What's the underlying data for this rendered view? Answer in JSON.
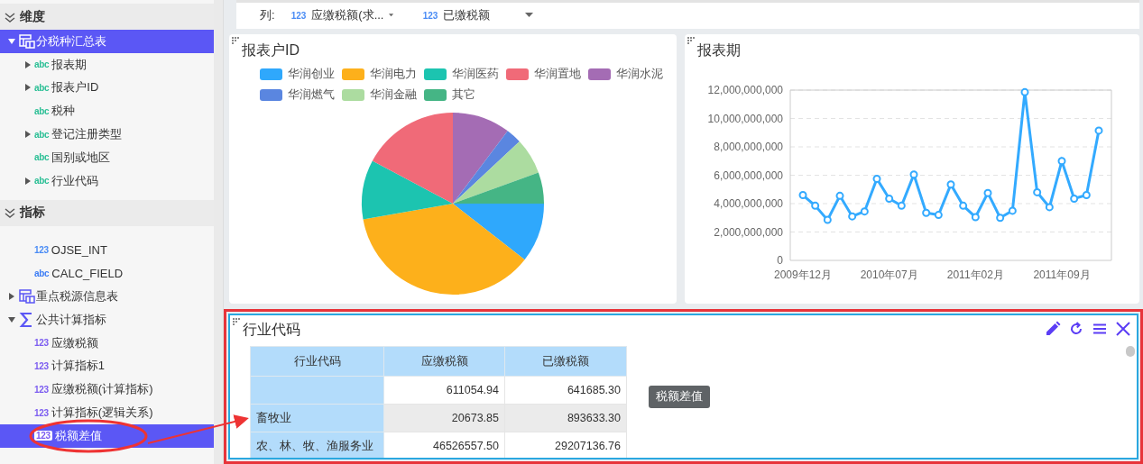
{
  "sidebar": {
    "sections": [
      {
        "title": "维度",
        "items": [
          {
            "label": "分税种汇总表",
            "kind": "table",
            "expanded": true,
            "selected": true,
            "children": [
              {
                "label": "报表期",
                "kind": "field",
                "type_label": "abc",
                "color": "#2bbf95",
                "expanded": false,
                "selected": false
              },
              {
                "label": "报表户ID",
                "kind": "field",
                "type_label": "abc",
                "color": "#2bbf95",
                "expanded": false,
                "selected": false
              },
              {
                "label": "税种",
                "kind": "field",
                "type_label": "abc",
                "color": "#2bbf95",
                "selected": false
              },
              {
                "label": "登记注册类型",
                "kind": "field",
                "type_label": "abc",
                "color": "#2bbf95",
                "expanded": false,
                "selected": false
              },
              {
                "label": "国别或地区",
                "kind": "field",
                "type_label": "abc",
                "color": "#2bbf95",
                "selected": false
              },
              {
                "label": "行业代码",
                "kind": "field",
                "type_label": "abc",
                "color": "#2bbf95",
                "expanded": false,
                "selected": false
              }
            ]
          }
        ]
      },
      {
        "title": "指标",
        "items": [
          {
            "label": "OJSE_INT",
            "kind": "field",
            "type_label": "123",
            "color": "#4a8cf5",
            "selected": false
          },
          {
            "label": "CALC_FIELD",
            "kind": "field",
            "type_label": "abc",
            "color": "#3d7df5",
            "selected": false
          },
          {
            "label": "重点税源信息表",
            "kind": "table",
            "expanded": false,
            "selected": false
          },
          {
            "label": "公共计算指标",
            "kind": "group",
            "expanded": true,
            "selected": false,
            "children": [
              {
                "label": "应缴税额",
                "kind": "field",
                "type_label": "123",
                "color": "#7b5cf0",
                "selected": false
              },
              {
                "label": "计算指标1",
                "kind": "field",
                "type_label": "123",
                "color": "#7b5cf0",
                "selected": false
              },
              {
                "label": "应缴税额(计算指标)",
                "kind": "field",
                "type_label": "123",
                "color": "#7b5cf0",
                "selected": false
              },
              {
                "label": "计算指标(逻辑关系)",
                "kind": "field",
                "type_label": "123",
                "color": "#7b5cf0",
                "selected": false
              },
              {
                "label": "税额差值",
                "kind": "field",
                "type_label": "123",
                "color": "#7b5cf0",
                "selected": true
              }
            ]
          }
        ]
      }
    ]
  },
  "toolbar": {
    "label": "列:",
    "fields": [
      {
        "type_label": "123",
        "text": "应缴税额(求..."
      },
      {
        "type_label": "123",
        "text": "已缴税额"
      }
    ]
  },
  "pie_panel": {
    "title": "报表户ID",
    "legend": [
      {
        "label": "华润创业",
        "color": "#2fa8fc"
      },
      {
        "label": "华润电力",
        "color": "#fdb01b"
      },
      {
        "label": "华润医药",
        "color": "#1cc4b0"
      },
      {
        "label": "华润置地",
        "color": "#f06a78"
      },
      {
        "label": "华润水泥",
        "color": "#a46cb4"
      },
      {
        "label": "华润燃气",
        "color": "#5a86e0"
      },
      {
        "label": "华润金融",
        "color": "#acdca0"
      },
      {
        "label": "其它",
        "color": "#45b585"
      }
    ]
  },
  "line_panel": {
    "title": "报表期",
    "chart_data": {
      "type": "line",
      "grid": true,
      "categories": [
        "2009年12月",
        null,
        null,
        null,
        null,
        null,
        null,
        "2010年07月",
        null,
        null,
        null,
        null,
        null,
        null,
        "2011年02月",
        null,
        null,
        null,
        null,
        null,
        null,
        "2011年09月",
        null,
        null,
        null
      ],
      "series": [
        {
          "color": "#33aaff",
          "marker": "circle",
          "values": [
            4600000000,
            3850000000,
            2850000000,
            4550000000,
            3100000000,
            3450000000,
            5750000000,
            4350000000,
            3850000000,
            6050000000,
            3350000000,
            3200000000,
            5350000000,
            3850000000,
            3050000000,
            4750000000,
            3000000000,
            3500000000,
            11850000000,
            4800000000,
            3750000000,
            7000000000,
            4350000000,
            4600000000,
            9150000000
          ]
        }
      ],
      "yticks": [
        {
          "value": 0,
          "label": "0"
        },
        {
          "value": 2000000000,
          "label": "2,000,000,000"
        },
        {
          "value": 4000000000,
          "label": "4,000,000,000"
        },
        {
          "value": 6000000000,
          "label": "6,000,000,000"
        },
        {
          "value": 8000000000,
          "label": "8,000,000,000"
        },
        {
          "value": 10000000000,
          "label": "10,000,000,000"
        },
        {
          "value": 12000000000,
          "label": "12,000,000,000"
        }
      ],
      "ylim": [
        0,
        12000000000
      ]
    }
  },
  "table_panel": {
    "title": "行业代码",
    "tooltip": "税额差值",
    "table": {
      "columns": [
        "行业代码",
        "应缴税额",
        "已缴税额"
      ],
      "rows": [
        {
          "cells": [
            "",
            "611054.94",
            "641685.30"
          ],
          "hovered": false
        },
        {
          "cells": [
            "畜牧业",
            "20673.85",
            "893633.30"
          ],
          "hovered": true
        },
        {
          "cells": [
            "农、林、牧、渔服务业",
            "46526557.50",
            "29207136.76"
          ],
          "hovered": false
        }
      ]
    }
  }
}
